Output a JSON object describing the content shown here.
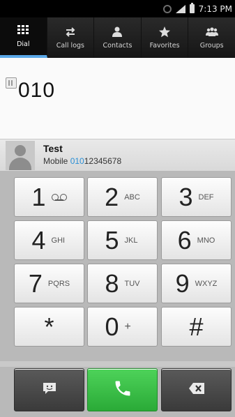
{
  "status_bar": {
    "time": "7:13 PM"
  },
  "tabs": [
    {
      "label": "Dial",
      "icon": "dialpad-icon",
      "active": true
    },
    {
      "label": "Call logs",
      "icon": "call-logs-icon",
      "active": false
    },
    {
      "label": "Contacts",
      "icon": "contacts-icon",
      "active": false
    },
    {
      "label": "Favorites",
      "icon": "star-icon",
      "active": false
    },
    {
      "label": "Groups",
      "icon": "groups-icon",
      "active": false
    }
  ],
  "dialed_number": "010",
  "suggestion": {
    "name": "Test",
    "type_label": "Mobile",
    "number_match": "010",
    "number_rest": "12345678"
  },
  "keys": [
    {
      "digit": "1",
      "letters": ""
    },
    {
      "digit": "2",
      "letters": "ABC"
    },
    {
      "digit": "3",
      "letters": "DEF"
    },
    {
      "digit": "4",
      "letters": "GHI"
    },
    {
      "digit": "5",
      "letters": "JKL"
    },
    {
      "digit": "6",
      "letters": "MNO"
    },
    {
      "digit": "7",
      "letters": "PQRS"
    },
    {
      "digit": "8",
      "letters": "TUV"
    },
    {
      "digit": "9",
      "letters": "WXYZ"
    },
    {
      "digit": "*",
      "letters": ""
    },
    {
      "digit": "0",
      "letters": "+"
    },
    {
      "digit": "#",
      "letters": ""
    }
  ],
  "colors": {
    "active_tab_underline": "#5aa8e8",
    "call_button": "#2aaa37",
    "match_highlight": "#2a8fd6"
  }
}
